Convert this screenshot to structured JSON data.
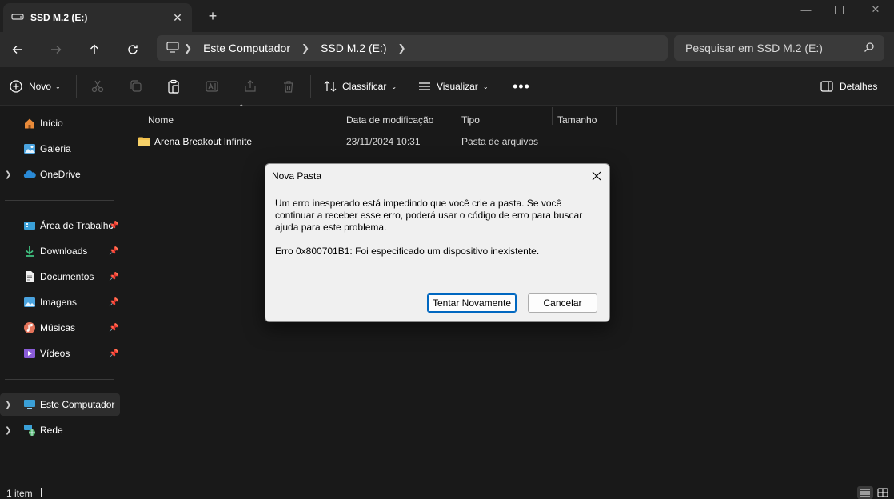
{
  "tab": {
    "title": "SSD M.2 (E:)"
  },
  "address": {
    "crumbs": [
      "Este Computador",
      "SSD M.2 (E:)"
    ]
  },
  "search": {
    "placeholder": "Pesquisar em SSD M.2 (E:)"
  },
  "toolbar": {
    "new_label": "Novo",
    "sort_label": "Classificar",
    "view_label": "Visualizar",
    "details_label": "Detalhes"
  },
  "sidebar": {
    "items": [
      {
        "label": "Início"
      },
      {
        "label": "Galeria"
      },
      {
        "label": "OneDrive"
      },
      {
        "label": "Área de Trabalho"
      },
      {
        "label": "Downloads"
      },
      {
        "label": "Documentos"
      },
      {
        "label": "Imagens"
      },
      {
        "label": "Músicas"
      },
      {
        "label": "Vídeos"
      },
      {
        "label": "Este Computador"
      },
      {
        "label": "Rede"
      }
    ]
  },
  "columns": {
    "name": "Nome",
    "date": "Data de modificação",
    "type": "Tipo",
    "size": "Tamanho"
  },
  "files": [
    {
      "name": "Arena Breakout Infinite",
      "date": "23/11/2024 10:31",
      "type": "Pasta de arquivos",
      "size": ""
    }
  ],
  "status": {
    "count": "1 item"
  },
  "dialog": {
    "title": "Nova Pasta",
    "message": "Um erro inesperado está impedindo que você crie a pasta. Se você continuar a receber esse erro, poderá usar o código de erro para buscar ajuda para este problema.",
    "error": "Erro 0x800701B1: Foi especificado um dispositivo inexistente.",
    "retry_label": "Tentar Novamente",
    "cancel_label": "Cancelar"
  },
  "colors": {
    "accent": "#0067c0",
    "folder": "#f2c14e"
  }
}
